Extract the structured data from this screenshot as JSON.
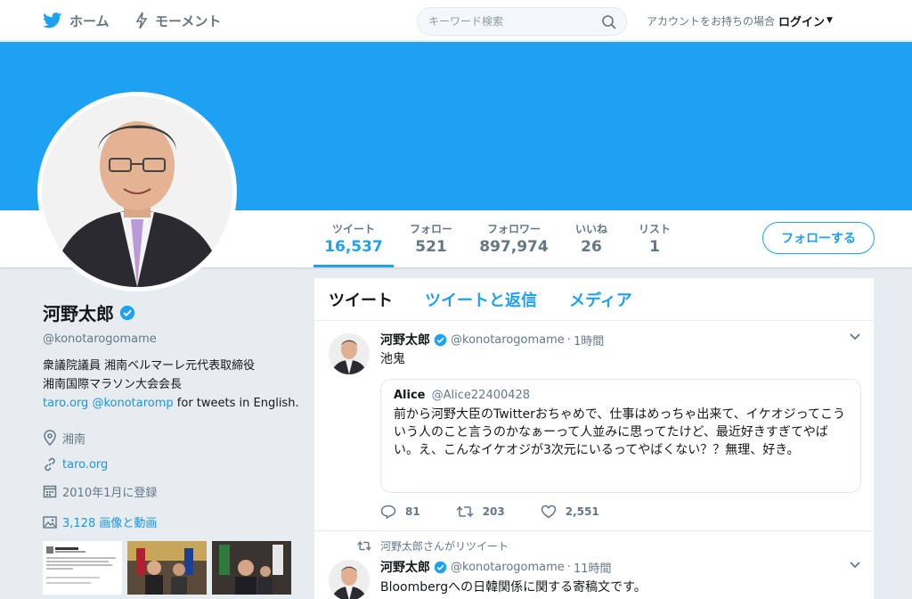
{
  "nav": {
    "home_label": "ホーム",
    "moments_label": "モーメント",
    "search_placeholder": "キーワード検索",
    "login_prompt": "アカウントをお持ちの場合",
    "login_label": "ログイン"
  },
  "colors": {
    "brand": "#1da1f2",
    "banner": "#1da1f2",
    "link": "#1b95e0"
  },
  "stats": {
    "tweets": {
      "label": "ツイート",
      "value": "16,537"
    },
    "following": {
      "label": "フォロー",
      "value": "521"
    },
    "followers": {
      "label": "フォロワー",
      "value": "897,974"
    },
    "likes": {
      "label": "いいね",
      "value": "26"
    },
    "lists": {
      "label": "リスト",
      "value": "1"
    }
  },
  "follow_button_label": "フォローする",
  "profile": {
    "name": "河野太郎",
    "handle": "@konotarogomame",
    "bio_line1": "衆議院議員 湘南ベルマーレ元代表取締役",
    "bio_line2": "湘南国際マラソン大会会長",
    "bio_link1": "taro.org",
    "bio_link2": "@konotaromp",
    "bio_tail": " for tweets in English.",
    "location": "湘南",
    "website": "taro.org",
    "joined": "2010年1月に登録",
    "media_count": "3,128 画像と動画"
  },
  "tabs": [
    {
      "label": "ツイート"
    },
    {
      "label": "ツイートと返信"
    },
    {
      "label": "メディア"
    }
  ],
  "tweets": [
    {
      "name": "河野太郎",
      "handle": "@konotarogomame",
      "time": "1時間",
      "text": "池鬼",
      "quote": {
        "name": "Alice",
        "handle": "@Alice22400428",
        "text": "前から河野大臣のTwitterおちゃめで、仕事はめっちゃ出来て、イケオジってこういう人のこと言うのかなぁーって人並みに思ってたけど、最近好きすぎてやばい。え、こんなイケオジが3次元にいるってやばくない？？無理、好き。"
      },
      "replies": "81",
      "retweets": "203",
      "likes": "2,551"
    },
    {
      "retweet_context": "河野太郎さんがリツイート",
      "name": "河野太郎",
      "handle": "@konotarogomame",
      "time": "11時間",
      "text": "Bloombergへの日韓関係に関する寄稿文です。"
    }
  ]
}
